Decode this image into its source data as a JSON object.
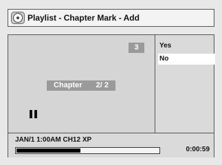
{
  "header": {
    "title": "Playlist - Chapter Mark - Add",
    "icon": "disc-icon"
  },
  "preview": {
    "chapter_number": "3",
    "chapter_label": "Chapter",
    "chapter_value": "2/ 2",
    "state_icon": "pause-icon"
  },
  "menu": {
    "items": [
      {
        "label": "Yes",
        "selected": false
      },
      {
        "label": "No",
        "selected": true
      }
    ]
  },
  "status": {
    "recording_info": "JAN/1 1:00AM CH12 XP",
    "elapsed": "0:00:59",
    "progress": 0.45
  },
  "colors": {
    "panel_bg": "#dadada",
    "badge_bg": "#9a9a9a",
    "selected_bg": "#ffffff",
    "progress_fill": "#000000"
  }
}
